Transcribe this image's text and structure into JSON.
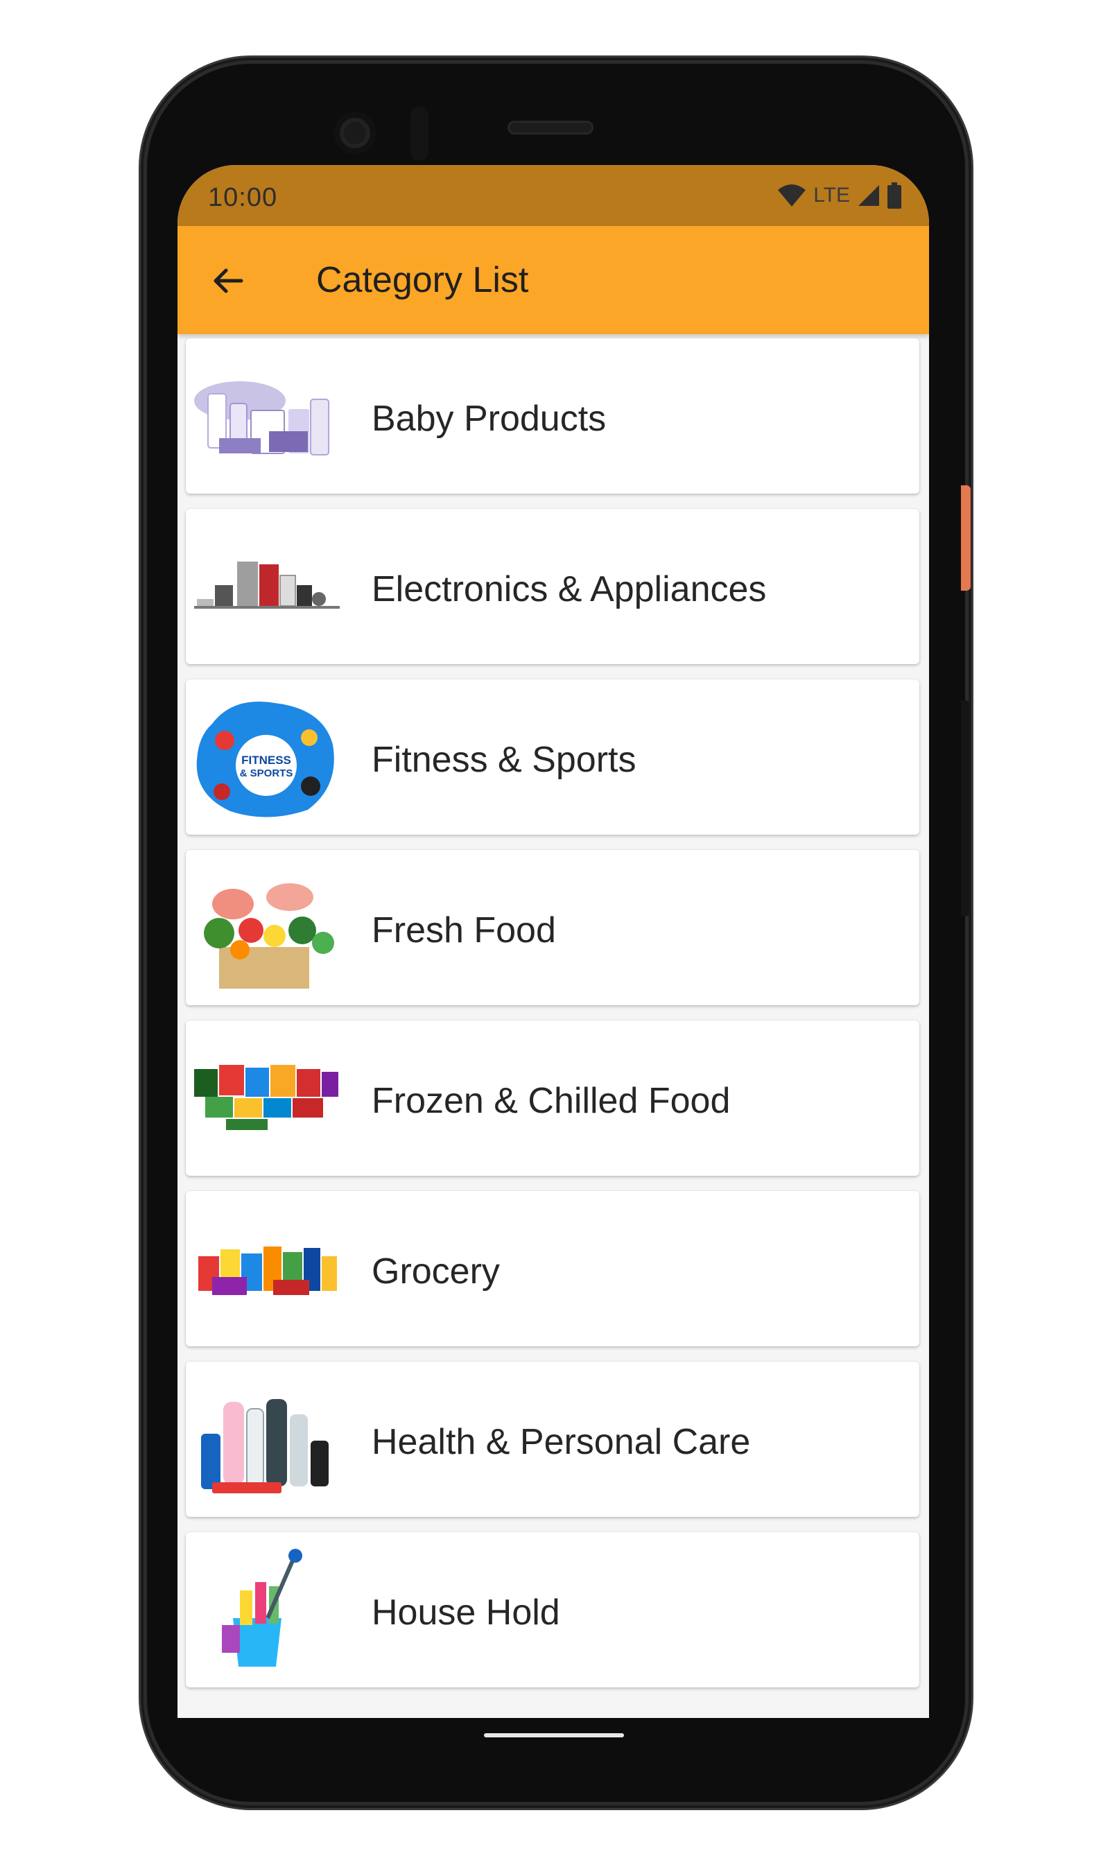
{
  "status_bar": {
    "time": "10:00",
    "network": "LTE",
    "icons": [
      "wifi-icon",
      "signal-icon",
      "battery-icon"
    ]
  },
  "app_bar": {
    "title": "Category List",
    "back_icon": "arrow-left-icon",
    "background": "#fba626"
  },
  "colors": {
    "status_bar": "#b97a1c",
    "app_bar": "#fba626",
    "list_background": "#f5f5f5",
    "card": "#ffffff"
  },
  "categories": [
    {
      "label": "Baby Products"
    },
    {
      "label": "Electronics & Appliances"
    },
    {
      "label": "Fitness & Sports"
    },
    {
      "label": "Fresh Food"
    },
    {
      "label": "Frozen & Chilled Food"
    },
    {
      "label": "Grocery"
    },
    {
      "label": "Health & Personal Care"
    },
    {
      "label": "House Hold"
    }
  ],
  "fitness_badge": {
    "line1": "FITNESS",
    "line2": "& SPORTS"
  }
}
